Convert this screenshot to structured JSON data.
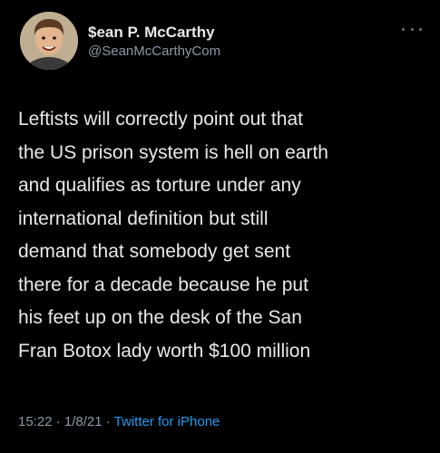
{
  "author": {
    "display_name": "$ean P. McCarthy",
    "handle": "@SeanMcCarthyCom",
    "avatar_icon": "profile-photo"
  },
  "more_icon": "more-options-icon",
  "tweet": {
    "lines": [
      "Leftists will correctly point out that",
      "the US prison system is hell on earth",
      "and qualifies as torture under any",
      "international definition but still",
      "demand that somebody get sent",
      "there for a decade because he put",
      "his feet up on the desk of the San",
      "Fran Botox lady worth $100 million"
    ]
  },
  "meta": {
    "time": "15:22",
    "separator": " · ",
    "date": "1/8/21",
    "source": "Twitter for iPhone"
  },
  "colors": {
    "background": "#000000",
    "text": "#e7e9ea",
    "muted": "#8b98a5",
    "link": "#1d9bf0"
  }
}
